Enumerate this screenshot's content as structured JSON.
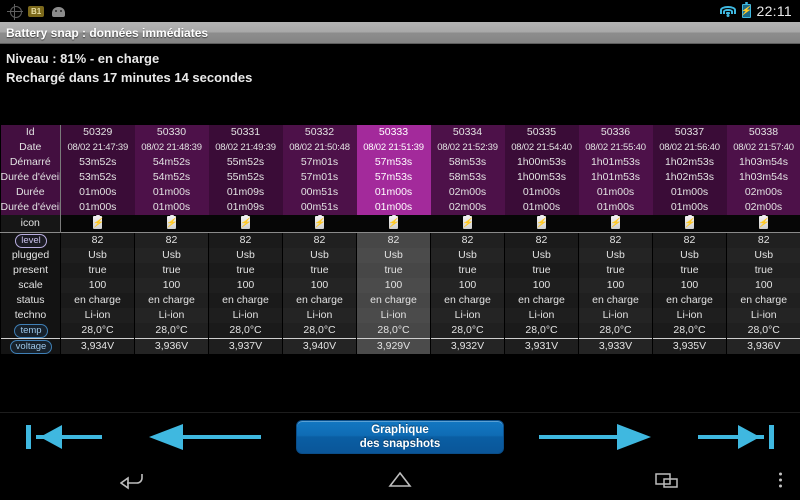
{
  "status_bar": {
    "icons": [
      "gps-icon",
      "b1-badge-icon",
      "android-robot-icon",
      "wifi-icon",
      "battery-charging-icon"
    ],
    "b1_label": "B1",
    "clock": "22:11"
  },
  "title_bar": {
    "title": "Battery snap : données immédiates"
  },
  "info": {
    "line1": "Niveau : 81% - en charge",
    "line2": "Rechargé dans 17 minutes 14 secondes"
  },
  "table": {
    "highlighted_column_index": 4,
    "columns": [
      "50329",
      "50330",
      "50331",
      "50332",
      "50333",
      "50334",
      "50335",
      "50336",
      "50337",
      "50338"
    ],
    "rows": [
      {
        "label": "Id",
        "zone": "purple",
        "values": [
          "50329",
          "50330",
          "50331",
          "50332",
          "50333",
          "50334",
          "50335",
          "50336",
          "50337",
          "50338"
        ]
      },
      {
        "label": "Date",
        "zone": "purple",
        "small": true,
        "values": [
          "08/02 21:47:39",
          "08/02 21:48:39",
          "08/02 21:49:39",
          "08/02 21:50:48",
          "08/02 21:51:39",
          "08/02 21:52:39",
          "08/02 21:54:40",
          "08/02 21:55:40",
          "08/02 21:56:40",
          "08/02 21:57:40"
        ]
      },
      {
        "label": "Démarré",
        "zone": "purple",
        "values": [
          "53m52s",
          "54m52s",
          "55m52s",
          "57m01s",
          "57m53s",
          "58m53s",
          "1h00m53s",
          "1h01m53s",
          "1h02m53s",
          "1h03m54s"
        ]
      },
      {
        "label": "Durée d'éveil",
        "zone": "purple",
        "values": [
          "53m52s",
          "54m52s",
          "55m52s",
          "57m01s",
          "57m53s",
          "58m53s",
          "1h00m53s",
          "1h01m53s",
          "1h02m53s",
          "1h03m54s"
        ]
      },
      {
        "label": "Durée",
        "zone": "purple",
        "values": [
          "01m00s",
          "01m00s",
          "01m09s",
          "00m51s",
          "01m00s",
          "02m00s",
          "01m00s",
          "01m00s",
          "01m00s",
          "02m00s"
        ]
      },
      {
        "label": "Durée d'éveil",
        "zone": "purple",
        "values": [
          "01m00s",
          "01m00s",
          "01m09s",
          "00m51s",
          "01m00s",
          "02m00s",
          "01m00s",
          "01m00s",
          "01m00s",
          "02m00s"
        ]
      },
      {
        "label": "icon",
        "zone": "icon",
        "values": [
          "battery-charging-icon",
          "battery-charging-icon",
          "battery-charging-icon",
          "battery-charging-icon",
          "battery-charging-icon",
          "battery-charging-icon",
          "battery-charging-icon",
          "battery-charging-icon",
          "battery-charging-icon",
          "battery-charging-icon"
        ]
      },
      {
        "label": "level",
        "badge": "level",
        "zone": "dark",
        "sep": true,
        "values": [
          "82",
          "82",
          "82",
          "82",
          "82",
          "82",
          "82",
          "82",
          "82",
          "82"
        ]
      },
      {
        "label": "plugged",
        "zone": "dark",
        "values": [
          "Usb",
          "Usb",
          "Usb",
          "Usb",
          "Usb",
          "Usb",
          "Usb",
          "Usb",
          "Usb",
          "Usb"
        ]
      },
      {
        "label": "present",
        "zone": "dark",
        "values": [
          "true",
          "true",
          "true",
          "true",
          "true",
          "true",
          "true",
          "true",
          "true",
          "true"
        ]
      },
      {
        "label": "scale",
        "zone": "dark",
        "values": [
          "100",
          "100",
          "100",
          "100",
          "100",
          "100",
          "100",
          "100",
          "100",
          "100"
        ]
      },
      {
        "label": "status",
        "zone": "dark",
        "values": [
          "en charge",
          "en charge",
          "en charge",
          "en charge",
          "en charge",
          "en charge",
          "en charge",
          "en charge",
          "en charge",
          "en charge"
        ]
      },
      {
        "label": "techno",
        "zone": "dark",
        "values": [
          "Li-ion",
          "Li-ion",
          "Li-ion",
          "Li-ion",
          "Li-ion",
          "Li-ion",
          "Li-ion",
          "Li-ion",
          "Li-ion",
          "Li-ion"
        ]
      },
      {
        "label": "temp",
        "badge": "blue",
        "zone": "dark",
        "values": [
          "28,0°C",
          "28,0°C",
          "28,0°C",
          "28,0°C",
          "28,0°C",
          "28,0°C",
          "28,0°C",
          "28,0°C",
          "28,0°C",
          "28,0°C"
        ]
      },
      {
        "label": "voltage",
        "badge": "blue",
        "zone": "dark",
        "seplight": true,
        "values": [
          "3,934V",
          "3,936V",
          "3,937V",
          "3,940V",
          "3,929V",
          "3,932V",
          "3,931V",
          "3,933V",
          "3,935V",
          "3,936V"
        ]
      }
    ]
  },
  "action_bar": {
    "first_button": "arrow-first-icon",
    "prev_button": "arrow-prev-icon",
    "graph_button_line1": "Graphique",
    "graph_button_line2": "des snapshots",
    "next_button": "arrow-next-icon",
    "last_button": "arrow-last-icon",
    "accent_color": "#3fb8e0"
  },
  "nav_bar": {
    "back": "back-icon",
    "home": "home-icon",
    "recents": "recents-icon",
    "overflow": "overflow-menu-icon"
  }
}
